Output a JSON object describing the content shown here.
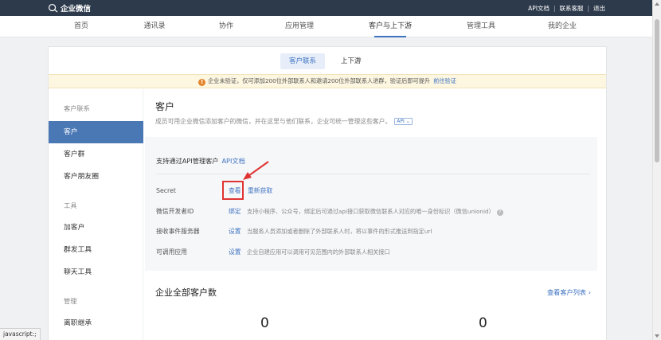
{
  "topbar": {
    "logo_text": "企业微信",
    "links": [
      "API文档",
      "联系客服",
      "退出"
    ]
  },
  "nav": {
    "items": [
      "首页",
      "通讯录",
      "协作",
      "应用管理",
      "客户与上下游",
      "管理工具",
      "我的企业"
    ],
    "active": "客户与上下游"
  },
  "subtabs": {
    "items": [
      "客户联系",
      "上下游"
    ],
    "active": "客户联系"
  },
  "notice": {
    "text": "企业未验证，仅可添加200位外部联系人和邀请200位外部联系人进群，验证后即可提升",
    "link": "前往验证"
  },
  "sidebar": {
    "groups": [
      {
        "title": "客户联系",
        "items": [
          "客户",
          "客户群",
          "客户朋友圈"
        ]
      },
      {
        "title": "工具",
        "items": [
          "加客户",
          "群发工具",
          "聊天工具"
        ]
      },
      {
        "title": "管理",
        "items": [
          "离职继承"
        ]
      }
    ],
    "active": "客户"
  },
  "main": {
    "title": "客户",
    "description": "成员可用企业微信添加客户的微信，并在这里与他们联系，企业可统一管理这些客户。",
    "api_badge": "API",
    "card": {
      "head_text": "支持通过API管理客户",
      "head_link": "API文档",
      "rows": [
        {
          "label": "Secret",
          "action": "查看",
          "action2": "重新获取",
          "info": ""
        },
        {
          "label": "微信开发者ID",
          "action": "绑定",
          "info": "支持小程序、公众号，绑定后可通过api接口获取微信联系人对应的唯一身份标识（微信unionid）"
        },
        {
          "label": "接收事件服务器",
          "action": "设置",
          "info": "当服务人员添加或者删除了外部联系人时，将以事件的形式推送到指定url"
        },
        {
          "label": "可调用应用",
          "action": "设置",
          "info": "企业自建应用可以调用可见范围内的外部联系人相关接口"
        }
      ]
    },
    "stats": {
      "title": "企业全部客户数",
      "link": "查看客户列表",
      "values": [
        "0",
        "0"
      ]
    }
  },
  "statusbar": {
    "text": "javascript:;"
  },
  "colors": {
    "topbar": "#2d3a4b",
    "accent": "#3f73c2",
    "sidebar_active": "#4a78b5",
    "highlight": "#e03434"
  }
}
